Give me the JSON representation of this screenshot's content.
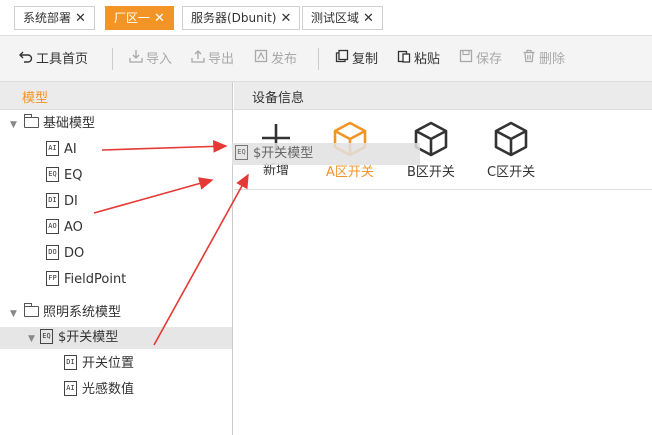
{
  "tabs": [
    {
      "label": "系统部署",
      "close": "✕",
      "active": false
    },
    {
      "label": "厂区一",
      "close": "✕",
      "active": true
    },
    {
      "label": "服务器(Dbunit)",
      "close": "✕",
      "active": false
    },
    {
      "label": "测试区域",
      "close": "✕",
      "active": false
    }
  ],
  "toolbar": {
    "home": "工具首页",
    "import": "导入",
    "export": "导出",
    "publish": "发布",
    "copy": "复制",
    "paste": "粘贴",
    "save": "保存",
    "delete": "删除"
  },
  "left_panel": {
    "title": "模型",
    "groups": [
      {
        "label": "基础模型",
        "items": [
          {
            "icon": "AI",
            "label": "AI"
          },
          {
            "icon": "EQ",
            "label": "EQ"
          },
          {
            "icon": "DI",
            "label": "DI"
          },
          {
            "icon": "AO",
            "label": "AO"
          },
          {
            "icon": "DO",
            "label": "DO"
          },
          {
            "icon": "FP",
            "label": "FieldPoint"
          }
        ]
      },
      {
        "label": "照明系统模型",
        "items": [
          {
            "icon": "EQ",
            "label": "$开关模型",
            "selected": true,
            "children": [
              {
                "icon": "DI",
                "label": "开关位置"
              },
              {
                "icon": "AI",
                "label": "光感数值"
              }
            ]
          }
        ]
      }
    ]
  },
  "right_panel": {
    "title": "设备信息",
    "devices": [
      {
        "icon": "plus-icon",
        "label": "新增"
      },
      {
        "icon": "cube-icon",
        "label": "A区开关",
        "active": true
      },
      {
        "icon": "cube-icon",
        "label": "B区开关"
      },
      {
        "icon": "cube-icon",
        "label": "C区开关"
      }
    ]
  },
  "drag_ghost": {
    "icon": "EQ",
    "label": "$开关模型"
  },
  "colors": {
    "accent": "#f39526",
    "arrow": "#e53935",
    "text": "#333333",
    "disabled": "#a8a8a8"
  }
}
